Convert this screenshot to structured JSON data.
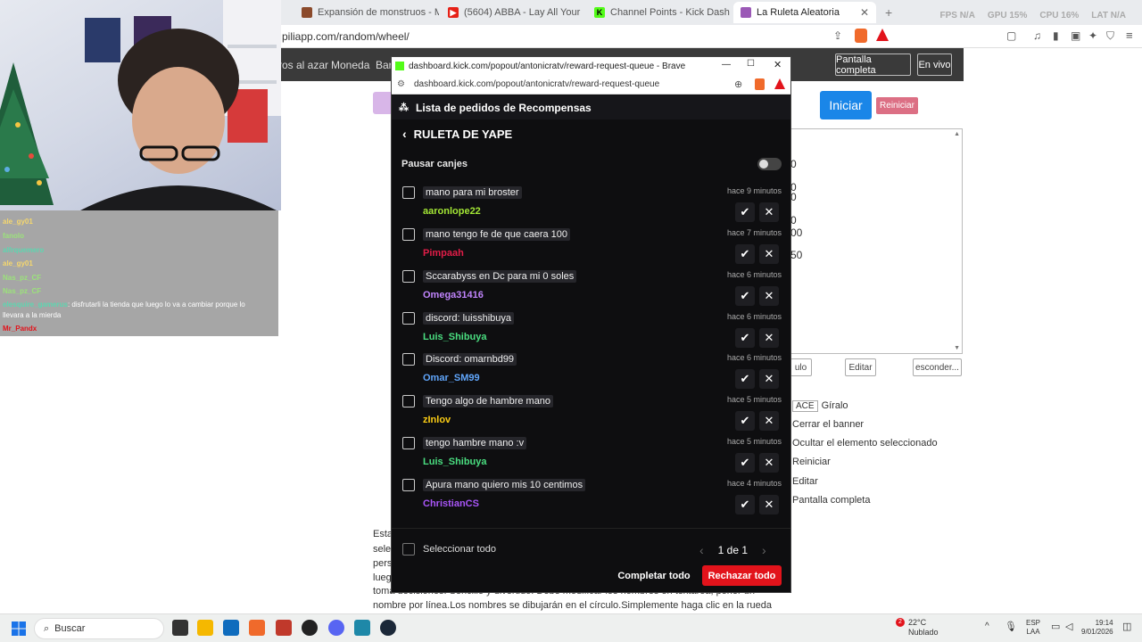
{
  "browser": {
    "tabs": [
      {
        "label": "Expansión de monstruos - Mods - M",
        "color": "#8b4a2b"
      },
      {
        "label": "(5604) ABBA - Lay All Your Love O",
        "color": "#e62117"
      },
      {
        "label": "Channel Points - Kick Dashboard",
        "color": "#53fc18"
      },
      {
        "label": "La Ruleta Aleatoria",
        "color": "#9b59b6"
      }
    ],
    "url": "piliapp.com/random/wheel/",
    "stats": {
      "fps": "FPS N/A",
      "gpu": "GPU 15%",
      "cpu": "CPU 16%",
      "lat": "LAT N/A"
    }
  },
  "background_page": {
    "nav": {
      "item1": "ros al azar",
      "item2": "Moneda",
      "item3": "Bar",
      "fullscreen": "Pantalla completa",
      "live": "En vivo"
    },
    "start_label": "Iniciar",
    "reset_label": "Reiniciar",
    "name_peeks": [
      "0",
      "0",
      "0",
      "0",
      "00",
      "50"
    ],
    "buttons": {
      "title_suffix": "ulo",
      "edit": "Editar",
      "hide": "esconder..."
    },
    "shortcuts": [
      {
        "key": "ACE",
        "label": "Gíralo"
      },
      {
        "key": "",
        "label": "Cerrar el banner"
      },
      {
        "key": "",
        "label": "Ocultar el elemento seleccionado"
      },
      {
        "key": "",
        "label": "Reiniciar"
      },
      {
        "key": "",
        "label": "Editar"
      },
      {
        "key": "",
        "label": "Pantalla completa"
      }
    ],
    "paragraph": {
      "line1": "Esta",
      "line2": "sele",
      "line3": "pers",
      "line4": "lueg",
      "line5": "toma decisiones. Sencillo y divertido. Debe modificar los nombres en textarea, poner un",
      "line6": "nombre por línea.Los nombres se dibujarán en el círculo.Simplemente haga clic en la rueda"
    }
  },
  "chat": [
    {
      "user": "ale_gy01",
      "msg": "",
      "color": "#f5d76e"
    },
    {
      "user": "fanolo",
      "msg": "",
      "color": "#9be37a"
    },
    {
      "user": "alfrquemero",
      "msg": "",
      "color": "#5dd6b0"
    },
    {
      "user": "ale_gy01",
      "msg": "",
      "color": "#f5d76e"
    },
    {
      "user": "Nas_pz_CF",
      "msg": "",
      "color": "#9be37a"
    },
    {
      "user": "Nas_pz_CF",
      "msg": "",
      "color": "#9be37a"
    },
    {
      "user": "elesquire_gamerus",
      "msg": ": disfrutarli la tienda que luego lo va a cambiar porque lo",
      "color": "#5dd6b0"
    },
    {
      "user": "",
      "msg": "llevara a la mierda",
      "color": "#fff"
    },
    {
      "user": "Mr_Pandx",
      "msg": "",
      "color": "#e2131b"
    }
  ],
  "popup": {
    "window_title": "dashboard.kick.com/popout/antonicratv/reward-request-queue - Brave",
    "address": "dashboard.kick.com/popout/antonicratv/reward-request-queue",
    "header": "Lista de pedidos de Recompensas",
    "reward_title": "RULETA DE YAPE",
    "pause_label": "Pausar canjes",
    "requests": [
      {
        "message": "mano para mi broster",
        "user": "aaronlope22",
        "time": "hace 9 minutos",
        "color": "#a3e635"
      },
      {
        "message": "mano tengo fe de que caera 100",
        "user": "Pimpaah",
        "time": "hace 7 minutos",
        "color": "#e11d48"
      },
      {
        "message": "Sccarabyss en Dc para mi 0 soles",
        "user": "Omega31416",
        "time": "hace 6 minutos",
        "color": "#c084fc"
      },
      {
        "message": "discord: luisshibuya",
        "user": "Luis_Shibuya",
        "time": "hace 6 minutos",
        "color": "#4ade80"
      },
      {
        "message": "Discord: omarnbd99",
        "user": "Omar_SM99",
        "time": "hace 6 minutos",
        "color": "#60a5fa"
      },
      {
        "message": "Tengo algo de hambre mano",
        "user": "zInlov",
        "time": "hace 5 minutos",
        "color": "#facc15"
      },
      {
        "message": "tengo hambre mano :v",
        "user": "Luis_Shibuya",
        "time": "hace 5 minutos",
        "color": "#4ade80"
      },
      {
        "message": "Apura mano quiero mis 10 centimos",
        "user": "ChristianCS",
        "time": "hace 4 minutos",
        "color": "#a855f7"
      }
    ],
    "select_all": "Seleccionar todo",
    "page": "1 de 1",
    "complete_all": "Completar todo",
    "reject_all": "Rechazar todo"
  },
  "taskbar": {
    "search": "Buscar",
    "weather_temp": "22°C",
    "weather_desc": "Nublado",
    "weather_badge": "2",
    "lang1": "ESP",
    "lang2": "LAA",
    "time": "19:14",
    "date": "9/01/2026"
  }
}
